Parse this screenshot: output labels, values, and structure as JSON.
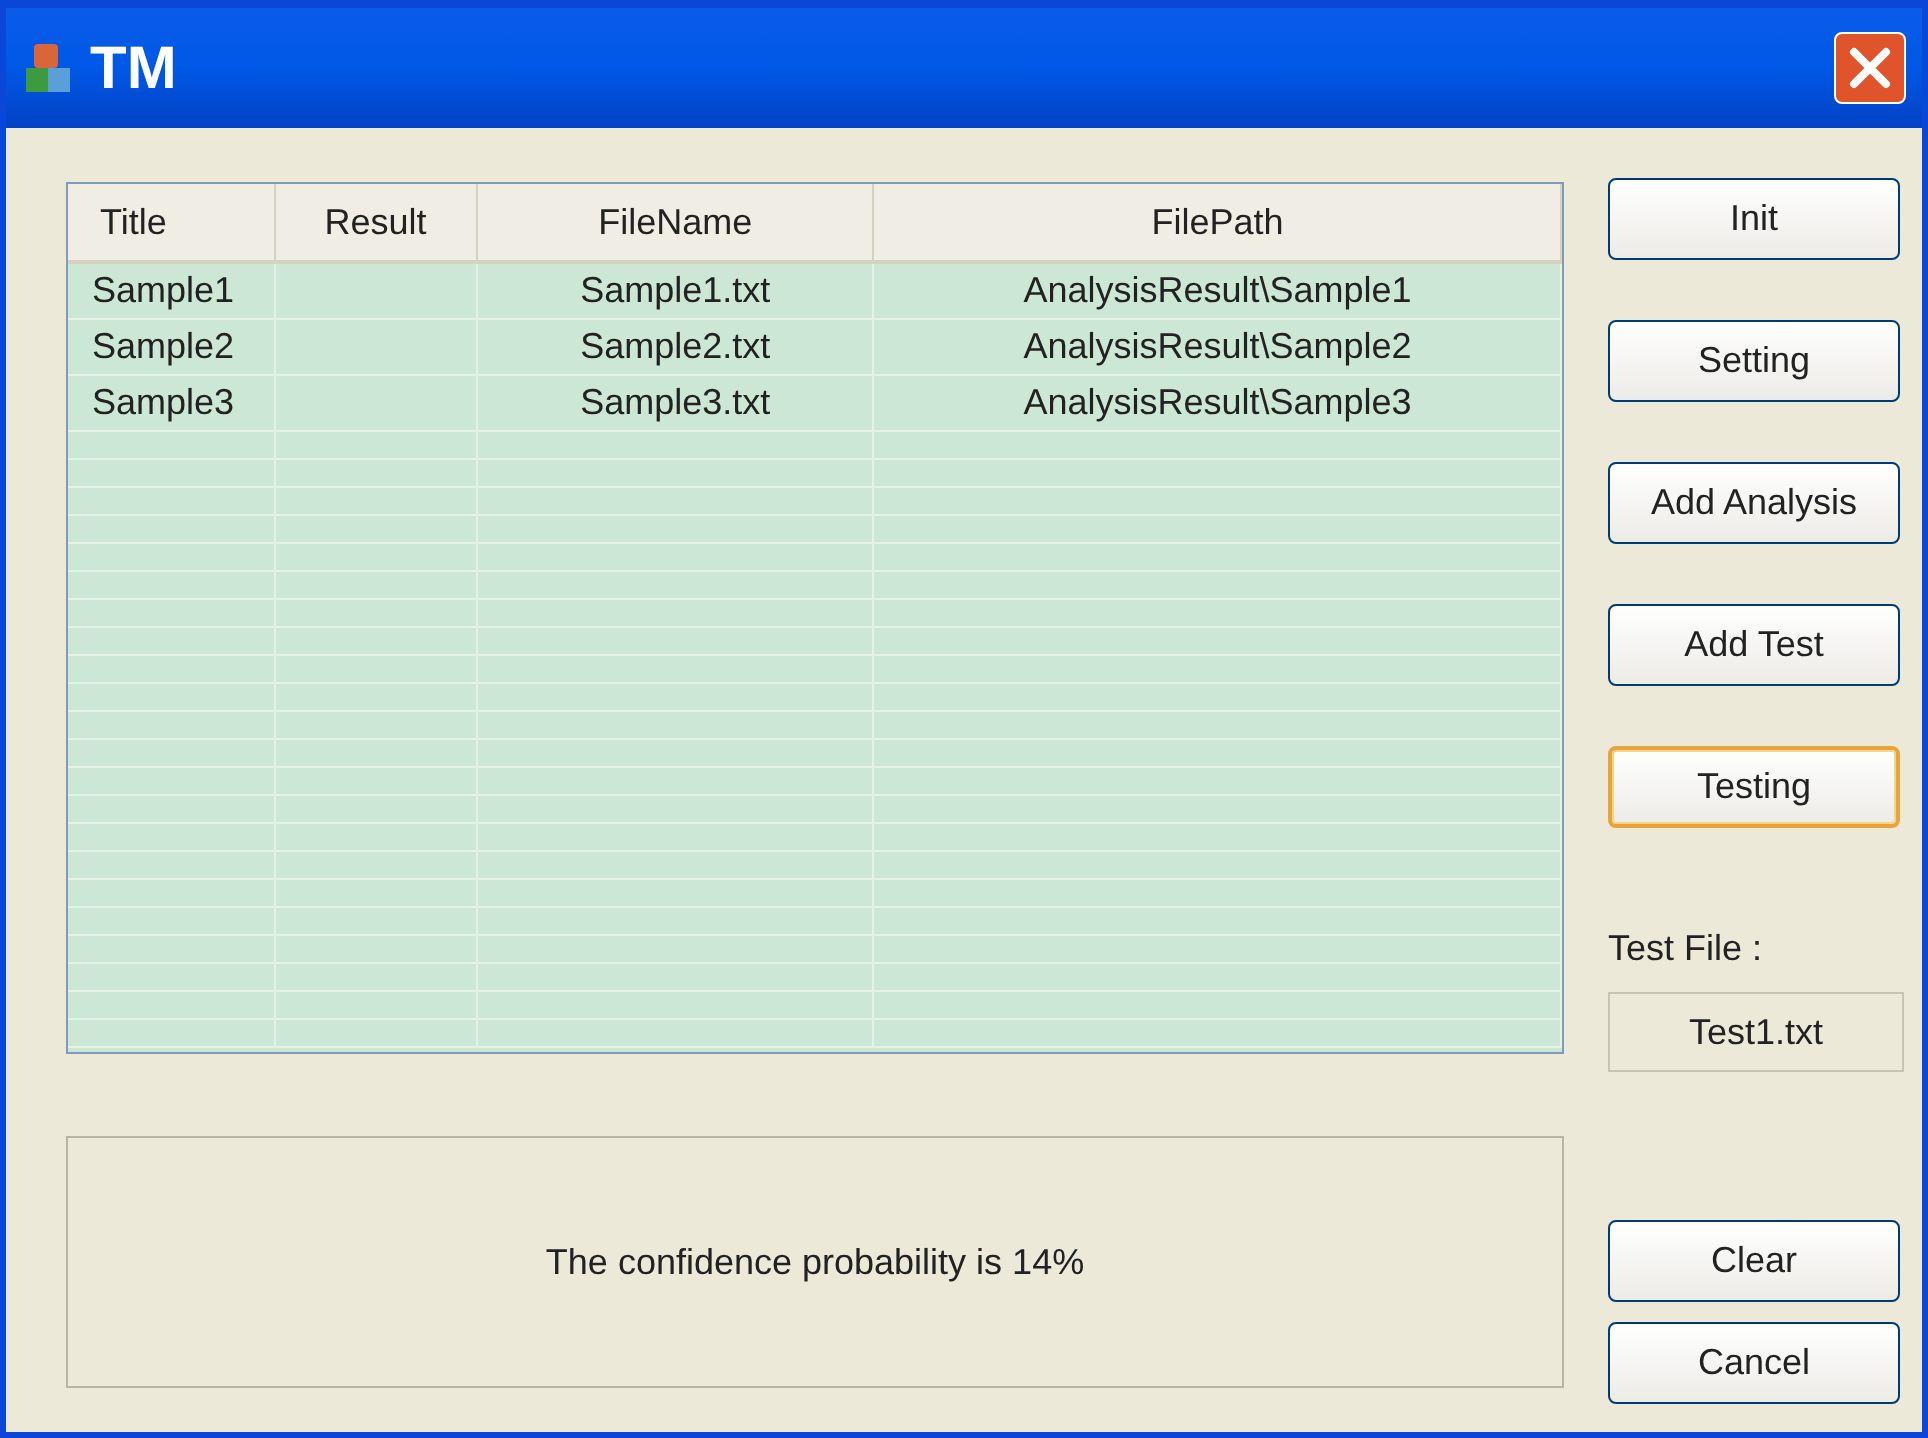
{
  "window": {
    "title": "TM"
  },
  "table": {
    "columns": [
      "Title",
      "Result",
      "FileName",
      "FilePath"
    ],
    "rows": [
      [
        "Sample1",
        "",
        "Sample1.txt",
        "AnalysisResult\\Sample1"
      ],
      [
        "Sample2",
        "",
        "Sample2.txt",
        "AnalysisResult\\Sample2"
      ],
      [
        "Sample3",
        "",
        "Sample3.txt",
        "AnalysisResult\\Sample3"
      ]
    ]
  },
  "buttons": [
    {
      "label": "Init",
      "focused": false
    },
    {
      "label": "Setting",
      "focused": false
    },
    {
      "label": "Add Analysis",
      "focused": false
    },
    {
      "label": "Add Test",
      "focused": false
    },
    {
      "label": "Testing",
      "focused": true
    }
  ],
  "test_file": {
    "label": "Test File :",
    "value": "Test1.txt"
  },
  "message": "The confidence probability is 14%",
  "bottom_buttons": [
    {
      "label": "Clear",
      "focused": false
    },
    {
      "label": "Cancel",
      "focused": false
    }
  ]
}
